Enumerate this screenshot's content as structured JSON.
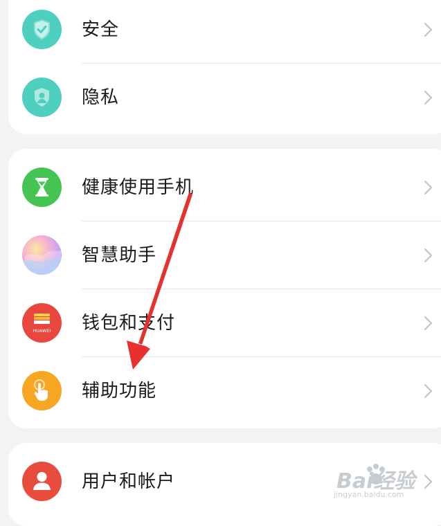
{
  "groups": [
    {
      "items": [
        {
          "label": "安全",
          "icon": "shield-check-icon",
          "color": "#4fcfbf"
        },
        {
          "label": "隐私",
          "icon": "privacy-shield-icon",
          "color": "#4fcfbf"
        }
      ]
    },
    {
      "items": [
        {
          "label": "健康使用手机",
          "icon": "hourglass-icon",
          "color": "#44c452"
        },
        {
          "label": "智慧助手",
          "icon": "smart-assistant-orb-icon",
          "color": "#f4a3c0"
        },
        {
          "label": "钱包和支付",
          "icon": "huawei-wallet-icon",
          "color": "#e8463f",
          "icon_text": "HUAWEI"
        },
        {
          "label": "辅助功能",
          "icon": "tap-hand-icon",
          "color": "#f6a623"
        }
      ]
    },
    {
      "items": [
        {
          "label": "用户和帐户",
          "icon": "user-icon",
          "color": "#e84c3d"
        }
      ]
    }
  ],
  "annotation": {
    "icon": "red-arrow-pointer",
    "color": "#e8302e"
  },
  "watermark": {
    "main": "Bai经验",
    "url": "jingyan.baidu.com"
  }
}
